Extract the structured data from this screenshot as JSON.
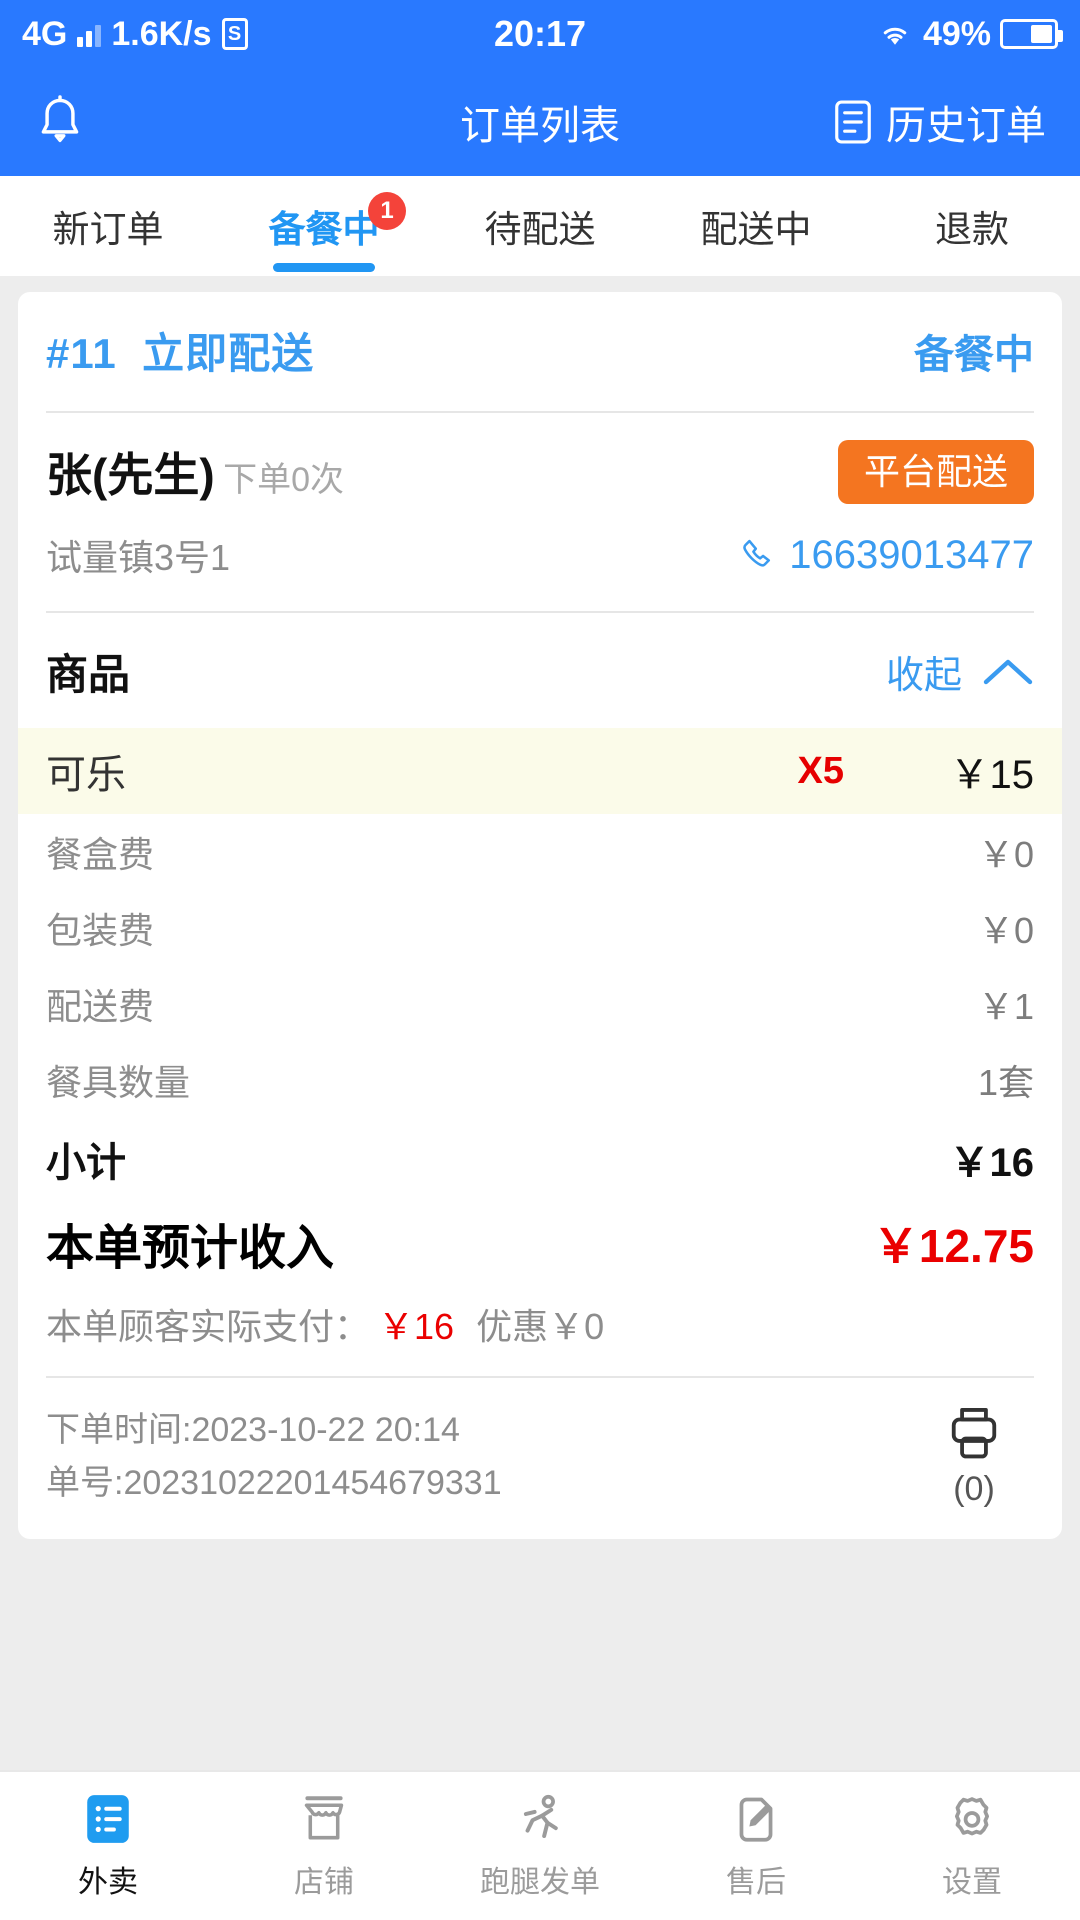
{
  "status_bar": {
    "network": "4G",
    "speed": "1.6K/s",
    "sim_label": "S",
    "time": "20:17",
    "battery_percent": "49%"
  },
  "app_bar": {
    "title": "订单列表",
    "bell_icon": "bell-icon",
    "history_label": "历史订单",
    "history_icon": "history-list-icon"
  },
  "tabs": [
    {
      "label": "新订单",
      "badge": "",
      "active": false
    },
    {
      "label": "备餐中",
      "badge": "1",
      "active": true
    },
    {
      "label": "待配送",
      "badge": "",
      "active": false
    },
    {
      "label": "配送中",
      "badge": "",
      "active": false
    },
    {
      "label": "退款",
      "badge": "",
      "active": false
    }
  ],
  "order": {
    "number": "#11",
    "delivery_type": "立即配送",
    "status": "备餐中",
    "customer_name": "张(先生)",
    "customer_order_count": "下单0次",
    "delivery_badge": "平台配送",
    "address": "试量镇3号1",
    "phone": "16639013477",
    "phone_icon": "phone-icon",
    "goods_title": "商品",
    "collapse_label": "收起",
    "collapse_icon": "chevron-up-icon",
    "items": [
      {
        "name": "可乐",
        "qty": "X5",
        "price": "￥15"
      }
    ],
    "fees": [
      {
        "label": "餐盒费",
        "value": "￥0"
      },
      {
        "label": "包装费",
        "value": "￥0"
      },
      {
        "label": "配送费",
        "value": "￥1"
      },
      {
        "label": "餐具数量",
        "value": "1套"
      }
    ],
    "subtotal_label": "小计",
    "subtotal_value": "￥16",
    "income_label": "本单预计收入",
    "income_value": "￥12.75",
    "paid_label": "本单顾客实际支付：",
    "paid_value": "￥16",
    "discount_label": "优惠￥0",
    "order_time": "下单时间:2023-10-22 20:14",
    "order_id": "单号:20231022201454679331",
    "printer_icon": "printer-icon",
    "print_count": "(0)"
  },
  "bottom_nav": [
    {
      "label": "外卖",
      "icon": "takeout-list-icon",
      "active": true
    },
    {
      "label": "店铺",
      "icon": "shop-icon",
      "active": false
    },
    {
      "label": "跑腿发单",
      "icon": "runner-icon",
      "active": false
    },
    {
      "label": "售后",
      "icon": "edit-note-icon",
      "active": false
    },
    {
      "label": "设置",
      "icon": "gear-icon",
      "active": false
    }
  ],
  "colors": {
    "primary": "#2979ff",
    "accent_blue": "#3a9bf0",
    "orange": "#f47520",
    "red": "#ea0000",
    "highlight": "#fbfbe9"
  }
}
